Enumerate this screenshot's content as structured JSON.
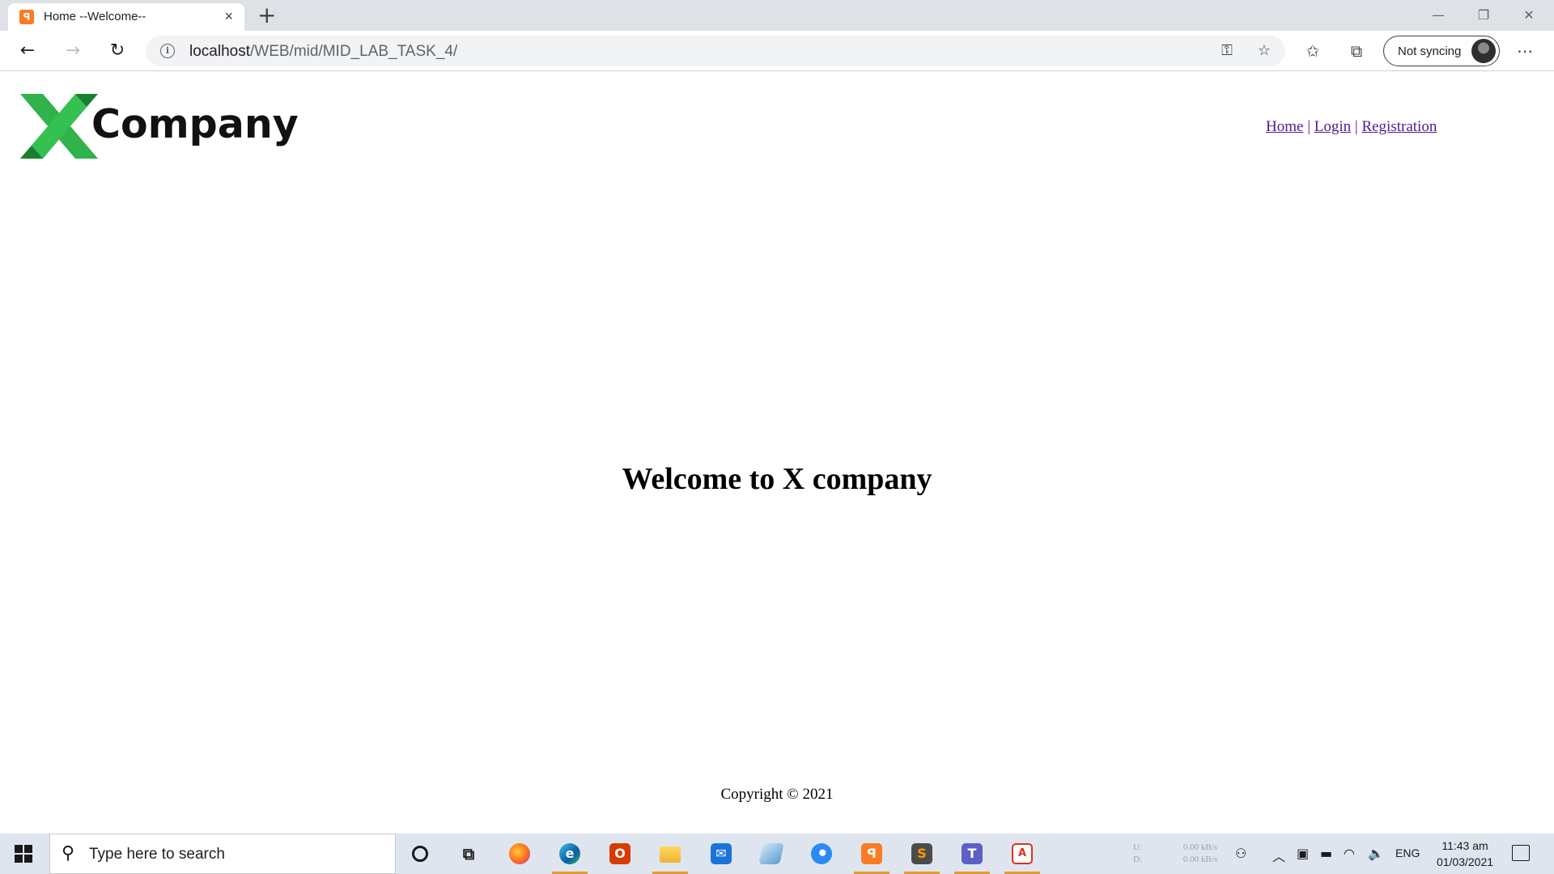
{
  "browser": {
    "tab": {
      "title": "Home --Welcome--",
      "favicon": "xampp-icon",
      "close": "×"
    },
    "new_tab": "+",
    "url": {
      "host": "localhost",
      "path": "/WEB/mid/MID_LAB_TASK_4/"
    },
    "sync_label": "Not syncing",
    "window_controls": {
      "minimize": "—",
      "restore": "❐",
      "close": "✕"
    }
  },
  "page": {
    "logo": {
      "letter": "X",
      "text": "Company",
      "colors": {
        "primary": "#2fb34a",
        "dark": "#1b7f32"
      }
    },
    "nav": {
      "home": "Home",
      "login": "Login",
      "registration": "Registration",
      "separator": "|"
    },
    "heading": "Welcome to X company",
    "footer": "Copyright © 2021"
  },
  "taskbar": {
    "search_placeholder": "Type here to search",
    "apps": [
      {
        "name": "cortana-icon",
        "glyph": "○"
      },
      {
        "name": "task-view-icon",
        "glyph": "⧉"
      },
      {
        "name": "firefox-icon",
        "glyph": "🦊"
      },
      {
        "name": "edge-icon",
        "glyph": "e"
      },
      {
        "name": "office-icon",
        "glyph": "O"
      },
      {
        "name": "file-explorer-icon",
        "glyph": "▭"
      },
      {
        "name": "mail-icon",
        "glyph": "✉"
      },
      {
        "name": "notes-icon",
        "glyph": "▰"
      },
      {
        "name": "thunderbird-icon",
        "glyph": "◉"
      },
      {
        "name": "xampp-icon",
        "glyph": "ꟼ"
      },
      {
        "name": "sublime-text-icon",
        "glyph": "S"
      },
      {
        "name": "teams-icon",
        "glyph": "T"
      },
      {
        "name": "acrobat-icon",
        "glyph": "A"
      }
    ],
    "net_speed": {
      "up_label": "U:",
      "up": "0.00 kB/s",
      "down_label": "D:",
      "down": "0.00 kB/s"
    },
    "language": "ENG",
    "time": "11:43 am",
    "date": "01/03/2021"
  }
}
